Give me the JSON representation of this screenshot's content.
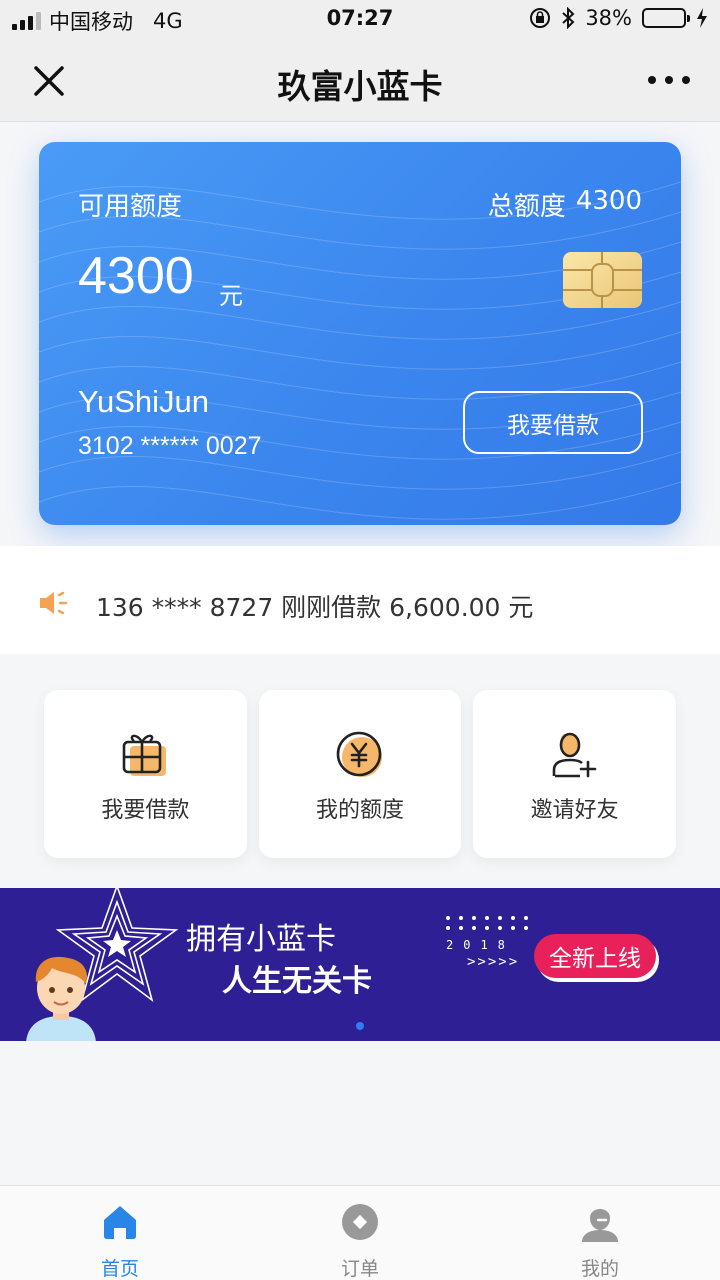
{
  "status_bar": {
    "carrier": "中国移动",
    "network": "4G",
    "time": "07:27",
    "battery": "38%",
    "battery_level": 0.38
  },
  "nav": {
    "title": "玖富小蓝卡"
  },
  "card": {
    "available_label": "可用额度",
    "total_label": "总额度",
    "total_value": "4300",
    "amount": "4300",
    "unit": "元",
    "holder_name": "YuShiJun",
    "card_number": "3102 ****** 0027",
    "borrow_button": "我要借款"
  },
  "notice": {
    "text": "136 **** 8727 刚刚借款 6,600.00 元"
  },
  "shortcuts": [
    {
      "label": "我要借款",
      "icon": "gift-icon"
    },
    {
      "label": "我的额度",
      "icon": "yuan-coin-icon"
    },
    {
      "label": "邀请好友",
      "icon": "add-user-icon"
    }
  ],
  "banner": {
    "line1": "拥有小蓝卡",
    "line2": "人生无关卡",
    "year": "2018",
    "arrows": ">>>>>",
    "badge": "全新上线"
  },
  "tabbar": [
    {
      "label": "首页",
      "icon": "home-icon",
      "active": true
    },
    {
      "label": "订单",
      "icon": "order-icon",
      "active": false
    },
    {
      "label": "我的",
      "icon": "profile-icon",
      "active": false
    }
  ],
  "colors": {
    "card_blue": "#3b86ee",
    "banner_purple": "#2e1f94",
    "accent_orange": "#f5a251",
    "tab_active": "#2a86e6",
    "badge_pink": "#e8215a"
  }
}
